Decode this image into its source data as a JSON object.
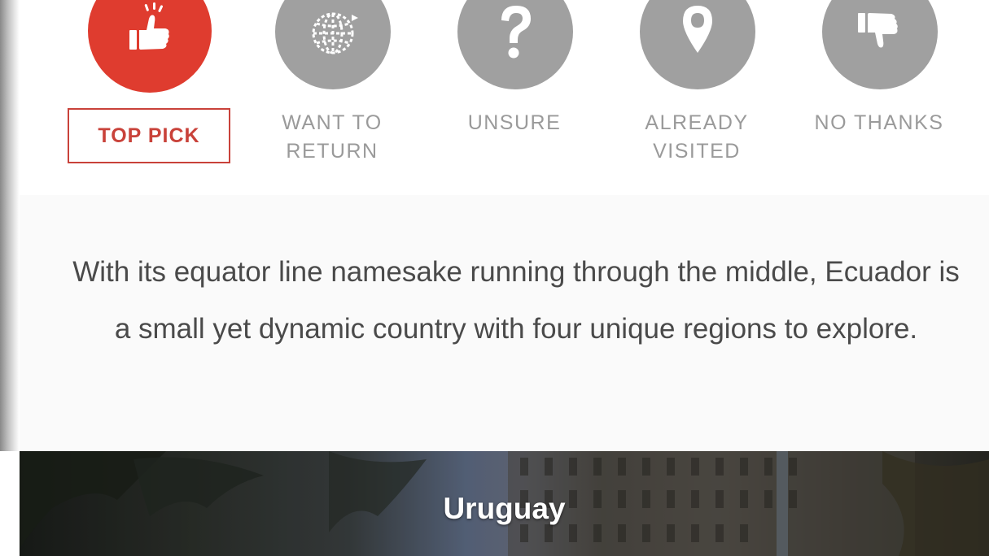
{
  "options": [
    {
      "key": "top_pick",
      "label": "TOP PICK",
      "icon": "thumbs-up-icon",
      "selected": true
    },
    {
      "key": "want_to_return",
      "label": "WANT TO\nRETURN",
      "icon": "globe-icon",
      "selected": false
    },
    {
      "key": "unsure",
      "label": "UNSURE",
      "icon": "question-mark-icon",
      "selected": false
    },
    {
      "key": "already_visited",
      "label": "ALREADY\nVISITED",
      "icon": "map-pin-icon",
      "selected": false
    },
    {
      "key": "no_thanks",
      "label": "NO THANKS",
      "icon": "thumbs-down-icon",
      "selected": false
    }
  ],
  "labels": {
    "top_pick": "TOP PICK",
    "want_to_return_line1": "WANT TO",
    "want_to_return_line2": "RETURN",
    "unsure": "UNSURE",
    "already_visited_line1": "ALREADY",
    "already_visited_line2": "VISITED",
    "no_thanks": "NO THANKS"
  },
  "description": "With its equator line namesake running through the middle, Ecuador is a small yet dynamic country with four unique regions to explore.",
  "next_destination": {
    "title": "Uruguay"
  },
  "colors": {
    "accent": "#df3c2f",
    "accent_border": "#c9423a",
    "unselected_circle": "#a0a0a0",
    "label_gray": "#9a9a9a",
    "body_text": "#4a4a4a"
  }
}
